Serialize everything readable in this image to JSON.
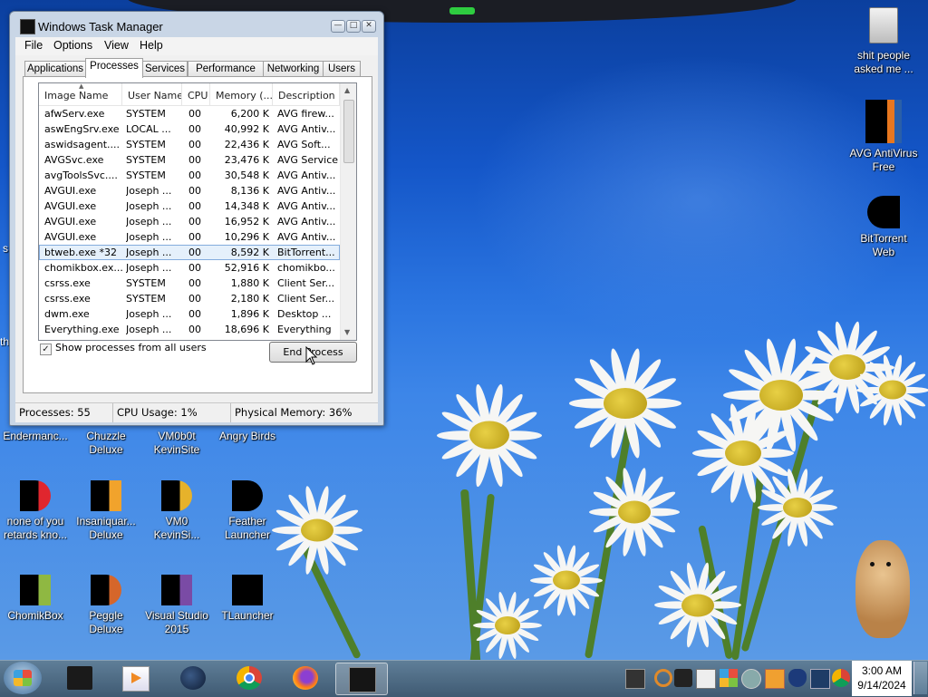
{
  "desktop_icons": {
    "shit_people": "shit people asked me ...",
    "avg": "AVG AntiVirus Free",
    "bittorrent": "BitTorrent Web",
    "endermanch": "Endermanc...",
    "chuzzle": "Chuzzle Deluxe",
    "vm0b0t": "VM0b0t KevinSite",
    "angry_birds": "Angry Birds",
    "none_of_you": "none of you retards kno...",
    "insaniquarium": "Insaniquar... Deluxe",
    "vm0_kevin": "VM0 KevinSi...",
    "feather": "Feather Launcher",
    "chomikbox": "ChomikBox",
    "peggle": "Peggle Deluxe",
    "visual_studio": "Visual Studio 2015",
    "tlauncher": "TLauncher",
    "partial_s": "s",
    "partial_th": "th"
  },
  "window": {
    "title": "Windows Task Manager",
    "minimize": "—",
    "maximize": "□",
    "close": "✕"
  },
  "menu": [
    "File",
    "Options",
    "View",
    "Help"
  ],
  "tabs": [
    "Applications",
    "Processes",
    "Services",
    "Performance",
    "Networking",
    "Users"
  ],
  "active_tab": "Processes",
  "columns": [
    "Image Name",
    "User Name",
    "CPU",
    "Memory (...",
    "Description"
  ],
  "processes": [
    {
      "name": "afwServ.exe",
      "user": "SYSTEM",
      "cpu": "00",
      "memory": "6,200 K",
      "desc": "AVG firew..."
    },
    {
      "name": "aswEngSrv.exe",
      "user": "LOCAL ...",
      "cpu": "00",
      "memory": "40,992 K",
      "desc": "AVG Antiv..."
    },
    {
      "name": "aswidsagent....",
      "user": "SYSTEM",
      "cpu": "00",
      "memory": "22,436 K",
      "desc": "AVG Soft..."
    },
    {
      "name": "AVGSvc.exe",
      "user": "SYSTEM",
      "cpu": "00",
      "memory": "23,476 K",
      "desc": "AVG Service"
    },
    {
      "name": "avgToolsSvc....",
      "user": "SYSTEM",
      "cpu": "00",
      "memory": "30,548 K",
      "desc": "AVG Antiv..."
    },
    {
      "name": "AVGUI.exe",
      "user": "Joseph ...",
      "cpu": "00",
      "memory": "8,136 K",
      "desc": "AVG Antiv..."
    },
    {
      "name": "AVGUI.exe",
      "user": "Joseph ...",
      "cpu": "00",
      "memory": "14,348 K",
      "desc": "AVG Antiv..."
    },
    {
      "name": "AVGUI.exe",
      "user": "Joseph ...",
      "cpu": "00",
      "memory": "16,952 K",
      "desc": "AVG Antiv..."
    },
    {
      "name": "AVGUI.exe",
      "user": "Joseph ...",
      "cpu": "00",
      "memory": "10,296 K",
      "desc": "AVG Antiv..."
    },
    {
      "name": "btweb.exe *32",
      "user": "Joseph ...",
      "cpu": "00",
      "memory": "8,592 K",
      "desc": "BitTorrent..."
    },
    {
      "name": "chomikbox.ex...",
      "user": "Joseph ...",
      "cpu": "00",
      "memory": "52,916 K",
      "desc": "chomikbo..."
    },
    {
      "name": "csrss.exe",
      "user": "SYSTEM",
      "cpu": "00",
      "memory": "1,880 K",
      "desc": "Client Ser..."
    },
    {
      "name": "csrss.exe",
      "user": "SYSTEM",
      "cpu": "00",
      "memory": "2,180 K",
      "desc": "Client Ser..."
    },
    {
      "name": "dwm.exe",
      "user": "Joseph ...",
      "cpu": "00",
      "memory": "1,896 K",
      "desc": "Desktop ..."
    },
    {
      "name": "Everything.exe",
      "user": "Joseph ...",
      "cpu": "00",
      "memory": "18,696 K",
      "desc": "Everything"
    }
  ],
  "selected_row": 9,
  "show_all_label": "Show processes from all users",
  "show_all_checked": "✓",
  "end_process": "End Process",
  "status": {
    "processes": "Processes: 55",
    "cpu": "CPU Usage: 1%",
    "memory": "Physical Memory: 36%"
  },
  "clock": {
    "time": "3:00 AM",
    "date": "9/14/2024"
  },
  "colors": {
    "accent": "#3399ff",
    "window_frame": "#c9d6e6",
    "taskbar": "#4d6a84"
  }
}
